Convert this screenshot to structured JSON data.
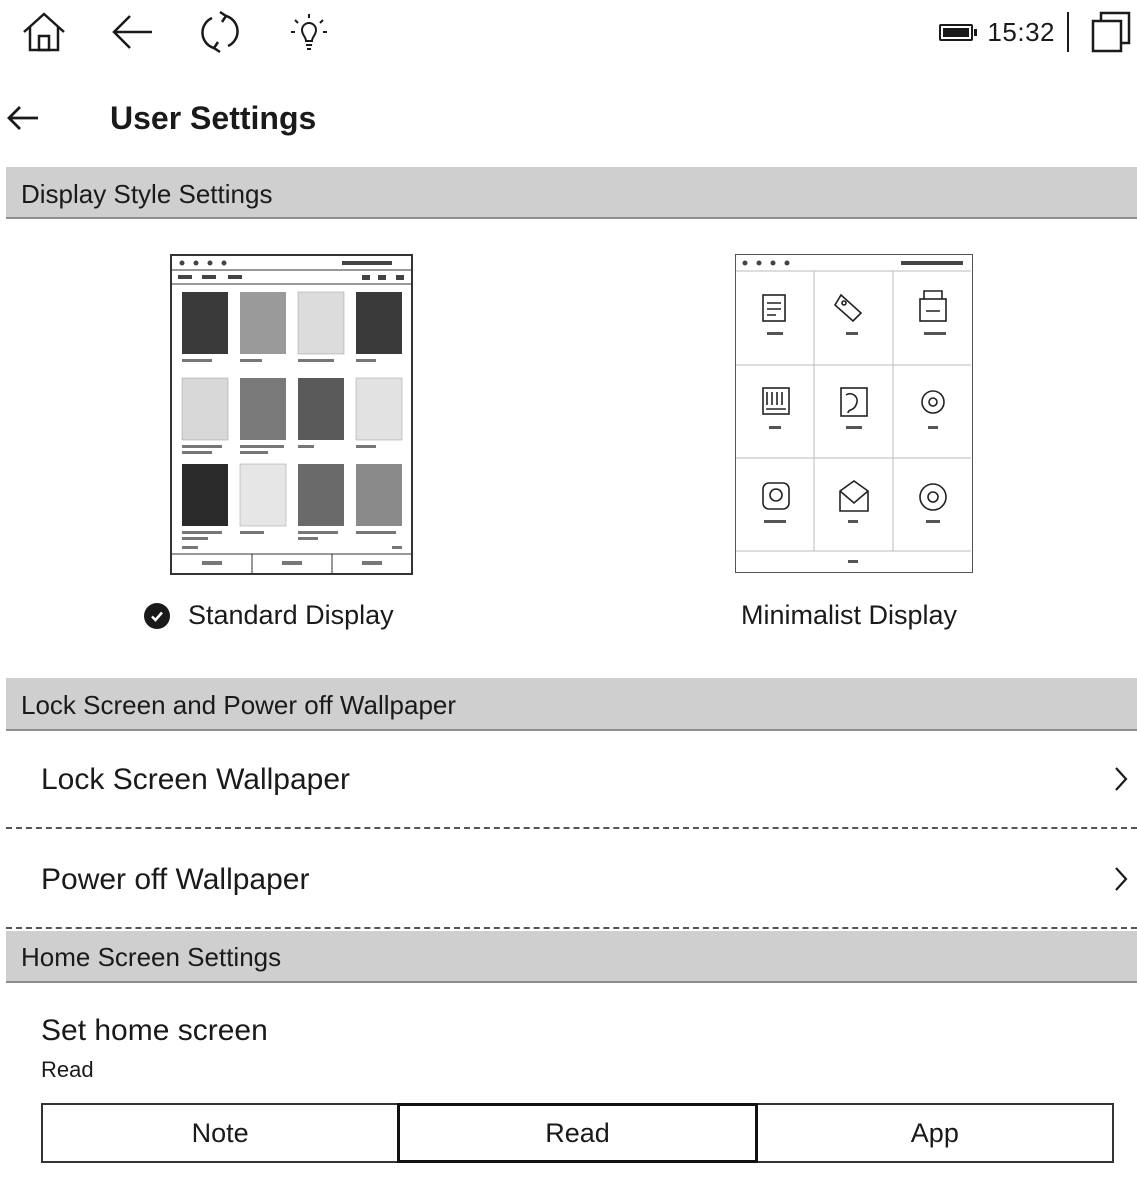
{
  "status_bar": {
    "icons": [
      "home-icon",
      "back-icon",
      "refresh-icon",
      "frontlight-icon"
    ],
    "battery_level": 1.0,
    "time": "15:32"
  },
  "header": {
    "title": "User Settings"
  },
  "sections": {
    "display_style": "Display Style Settings",
    "lock_power": "Lock Screen and Power off Wallpaper",
    "home_screen": "Home Screen Settings"
  },
  "display_options": {
    "standard": {
      "label": "Standard Display",
      "selected": true
    },
    "minimalist": {
      "label": "Minimalist Display",
      "selected": false
    }
  },
  "rows": {
    "lock_screen": "Lock Screen Wallpaper",
    "power_off": "Power off Wallpaper"
  },
  "home_screen": {
    "label": "Set home screen",
    "value": "Read",
    "options": [
      "Note",
      "Read",
      "App"
    ],
    "selected": "Read"
  },
  "colors": {
    "section_band": "#cfcfcf",
    "text": "#1a1a1a"
  }
}
